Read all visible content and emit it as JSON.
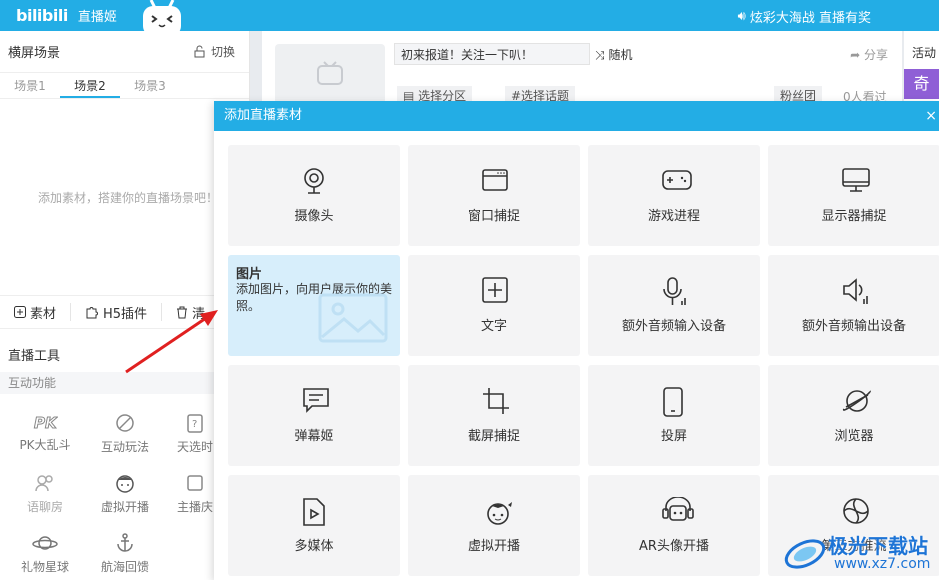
{
  "topbar": {
    "logo": "bilibili",
    "app_name": "直播姬",
    "promo": "炫彩大海战 直播有奖"
  },
  "left_panel": {
    "title": "横屏场景",
    "switch_label": "切换",
    "tabs": [
      "场景1",
      "场景2",
      "场景3"
    ],
    "active_tab": "场景2",
    "empty_hint": "添加素材，搭建你的直播场景吧！",
    "material_buttons": [
      "素材",
      "H5插件",
      "清"
    ],
    "tools_title": "直播工具",
    "tools_sub": "互动功能",
    "tools": [
      "PK大乱斗",
      "互动玩法",
      "天选时",
      "语聊房",
      "虚拟开播",
      "主播庆",
      "礼物星球",
      "航海回馈"
    ]
  },
  "middle": {
    "notice_value": "初来报道！关注一下叭！",
    "random_label": "随机",
    "share_label": "分享",
    "chips": [
      "选择分区",
      "#选择话题"
    ],
    "fans_label": "粉丝团",
    "watching": "0人看过"
  },
  "right_panel": {
    "activity": "活动",
    "badge": "奇"
  },
  "modal": {
    "title": "添加直播素材",
    "close": "×",
    "items": [
      {
        "label": "摄像头",
        "icon": "camera-icon"
      },
      {
        "label": "窗口捕捉",
        "icon": "window-icon"
      },
      {
        "label": "游戏进程",
        "icon": "gamepad-icon"
      },
      {
        "label": "显示器捕捉",
        "icon": "monitor-icon"
      },
      {
        "label": "图片",
        "icon": "image-icon"
      },
      {
        "label": "文字",
        "icon": "text-icon"
      },
      {
        "label": "额外音频输入设备",
        "icon": "microphone-icon"
      },
      {
        "label": "额外音频输出设备",
        "icon": "speaker-icon"
      },
      {
        "label": "弹幕姬",
        "icon": "danmaku-icon"
      },
      {
        "label": "截屏捕捉",
        "icon": "crop-icon"
      },
      {
        "label": "投屏",
        "icon": "phone-icon"
      },
      {
        "label": "浏览器",
        "icon": "browser-icon"
      },
      {
        "label": "多媒体",
        "icon": "media-file-icon"
      },
      {
        "label": "虚拟开播",
        "icon": "virtual-avatar-icon"
      },
      {
        "label": "AR头像开播",
        "icon": "ar-avatar-icon"
      },
      {
        "label": "第三方推流",
        "icon": "stream-icon"
      }
    ],
    "tooltip": {
      "title": "图片",
      "description": "添加图片，向用户展示你的美照。"
    }
  },
  "watermark": {
    "text": "极光下载站",
    "url": "www.xz7.com"
  },
  "colors": {
    "accent": "#23ade5",
    "highlight": "#d7eefb",
    "arrow": "#e02020"
  }
}
